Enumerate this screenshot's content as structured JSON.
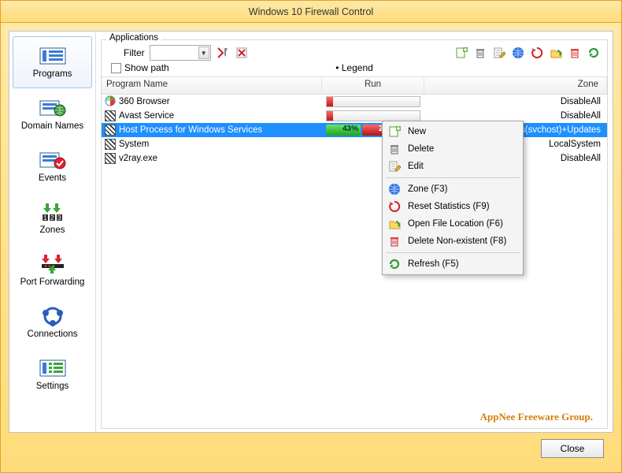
{
  "window": {
    "title": "Windows 10 Firewall Control"
  },
  "sidebar": {
    "items": [
      {
        "label": "Programs"
      },
      {
        "label": "Domain Names"
      },
      {
        "label": "Events"
      },
      {
        "label": "Zones"
      },
      {
        "label": "Port Forwarding"
      },
      {
        "label": "Connections"
      },
      {
        "label": "Settings"
      }
    ]
  },
  "group": {
    "label": "Applications",
    "filter_label": "Filter",
    "filter_value": "",
    "show_path_label": "Show path",
    "legend_label": "• Legend"
  },
  "columns": {
    "name": "Program Name",
    "run": "Run",
    "zone": "Zone"
  },
  "rows": [
    {
      "name": "360 Browser",
      "zone": "DisableAll",
      "icon": "color",
      "runbar": true
    },
    {
      "name": "Avast Service",
      "zone": "DisableAll",
      "icon": "hatch",
      "runbar": true
    },
    {
      "name": "Host Process for Windows Services",
      "zone": "HostProcess(svchost)+Updates",
      "icon": "hatch",
      "selected": true,
      "green": "43%",
      "red": "24%"
    },
    {
      "name": "System",
      "zone": "LocalSystem",
      "icon": "hatch"
    },
    {
      "name": "v2ray.exe",
      "zone": "DisableAll",
      "icon": "hatch"
    }
  ],
  "context_menu": {
    "items": [
      {
        "label": "New",
        "icon": "new"
      },
      {
        "label": "Delete",
        "icon": "trash"
      },
      {
        "label": "Edit",
        "icon": "edit"
      },
      {
        "sep": true
      },
      {
        "label": "Zone (F3)",
        "icon": "globe"
      },
      {
        "label": "Reset Statistics (F9)",
        "icon": "reset"
      },
      {
        "label": "Open File Location (F6)",
        "icon": "folder"
      },
      {
        "label": "Delete Non-existent (F8)",
        "icon": "trash-red"
      },
      {
        "sep": true
      },
      {
        "label": "Refresh (F5)",
        "icon": "refresh"
      }
    ]
  },
  "toolbar_icons": [
    "new",
    "trash",
    "edit",
    "globe",
    "reset",
    "folder",
    "trash-red",
    "refresh"
  ],
  "watermark": "AppNee Freeware Group.",
  "close_label": "Close"
}
